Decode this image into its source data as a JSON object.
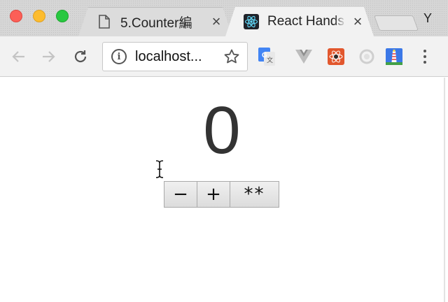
{
  "window": {
    "tabs": [
      {
        "title": "5.Counter編",
        "favicon": "document-icon",
        "active": false
      },
      {
        "title": "React Hands",
        "favicon": "react-icon",
        "active": true
      }
    ],
    "profile_initial": "Y"
  },
  "toolbar": {
    "url": "localhost...",
    "extensions": [
      "google-translate-icon",
      "vue-devtools-icon",
      "react-bug-icon",
      "extension-circle-icon",
      "lighthouse-icon"
    ]
  },
  "counter": {
    "value": "0",
    "buttons": {
      "decrement_label": "−",
      "increment_label": "+",
      "double_label": "**"
    }
  },
  "colors": {
    "titlebar": "#d6d6d6",
    "toolbar": "#f2f2f2",
    "counter_text": "#333333"
  }
}
